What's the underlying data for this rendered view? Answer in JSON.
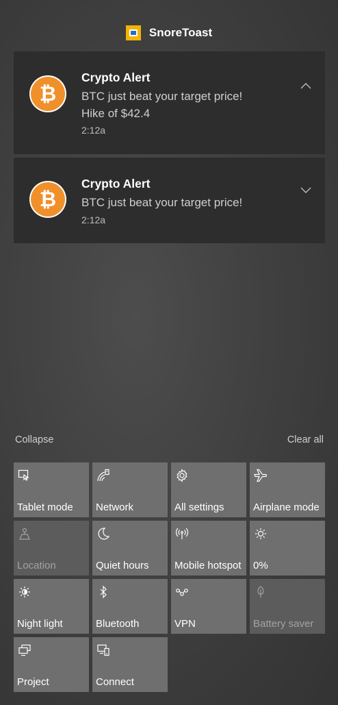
{
  "app": {
    "name": "SnoreToast",
    "icon": "snoretoast-app-icon"
  },
  "notifications": [
    {
      "icon": "bitcoin-icon",
      "title": "Crypto Alert",
      "body_lines": [
        "BTC just beat your target price!",
        "Hike of $42.4"
      ],
      "time": "2:12a",
      "toggle": "chevron-up-icon"
    },
    {
      "icon": "bitcoin-icon",
      "title": "Crypto Alert",
      "body_lines": [
        "BTC just beat your target price!"
      ],
      "time": "2:12a",
      "toggle": "chevron-down-icon"
    }
  ],
  "actions": {
    "collapse": "Collapse",
    "clear_all": "Clear all"
  },
  "tiles": [
    {
      "label": "Tablet mode",
      "icon": "tablet-mode-icon",
      "enabled": true
    },
    {
      "label": "Network",
      "icon": "network-icon",
      "enabled": true
    },
    {
      "label": "All settings",
      "icon": "gear-icon",
      "enabled": true
    },
    {
      "label": "Airplane mode",
      "icon": "airplane-icon",
      "enabled": true
    },
    {
      "label": "Location",
      "icon": "location-icon",
      "enabled": false
    },
    {
      "label": "Quiet hours",
      "icon": "moon-icon",
      "enabled": true
    },
    {
      "label": "Mobile hotspot",
      "icon": "hotspot-icon",
      "enabled": true
    },
    {
      "label": "0%",
      "icon": "brightness-icon",
      "enabled": true
    },
    {
      "label": "Night light",
      "icon": "night-light-icon",
      "enabled": true
    },
    {
      "label": "Bluetooth",
      "icon": "bluetooth-icon",
      "enabled": true
    },
    {
      "label": "VPN",
      "icon": "vpn-icon",
      "enabled": true
    },
    {
      "label": "Battery saver",
      "icon": "battery-saver-icon",
      "enabled": false
    },
    {
      "label": "Project",
      "icon": "project-icon",
      "enabled": true
    },
    {
      "label": "Connect",
      "icon": "connect-icon",
      "enabled": true
    }
  ],
  "colors": {
    "panel_background": "#404040",
    "toast_background": "#2d2d2d",
    "tile_on": "#6f6f6f",
    "tile_off": "#5c5c5c",
    "bitcoin_orange": "#f0902a",
    "app_icon_yellow": "#f4b400"
  }
}
